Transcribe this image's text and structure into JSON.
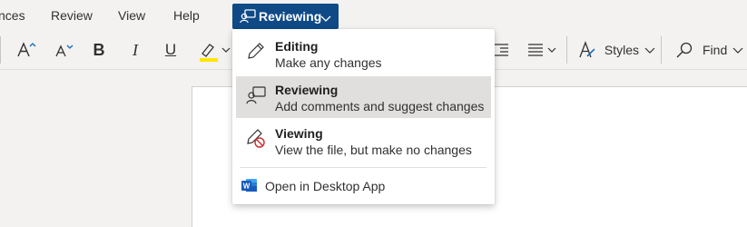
{
  "menubar": {
    "items": [
      "nces",
      "Review",
      "View",
      "Help"
    ]
  },
  "mode_button": {
    "label": "Reviewing",
    "icon": "reviewing-icon"
  },
  "toolbar": {
    "styles_label": "Styles",
    "find_label": "Find",
    "highlight_color": "#ffe600"
  },
  "mode_menu": {
    "options": [
      {
        "title": "Editing",
        "description": "Make any changes",
        "icon": "pencil-icon",
        "selected": false
      },
      {
        "title": "Reviewing",
        "description": "Add comments and suggest changes",
        "icon": "reviewing-icon",
        "selected": true
      },
      {
        "title": "Viewing",
        "description": "View the file, but make no changes",
        "icon": "pencil-prohibited-icon",
        "selected": false
      }
    ],
    "open_desktop_label": "Open in Desktop App",
    "word_icon_letter": "W",
    "word_brand_color": "#185abd"
  }
}
